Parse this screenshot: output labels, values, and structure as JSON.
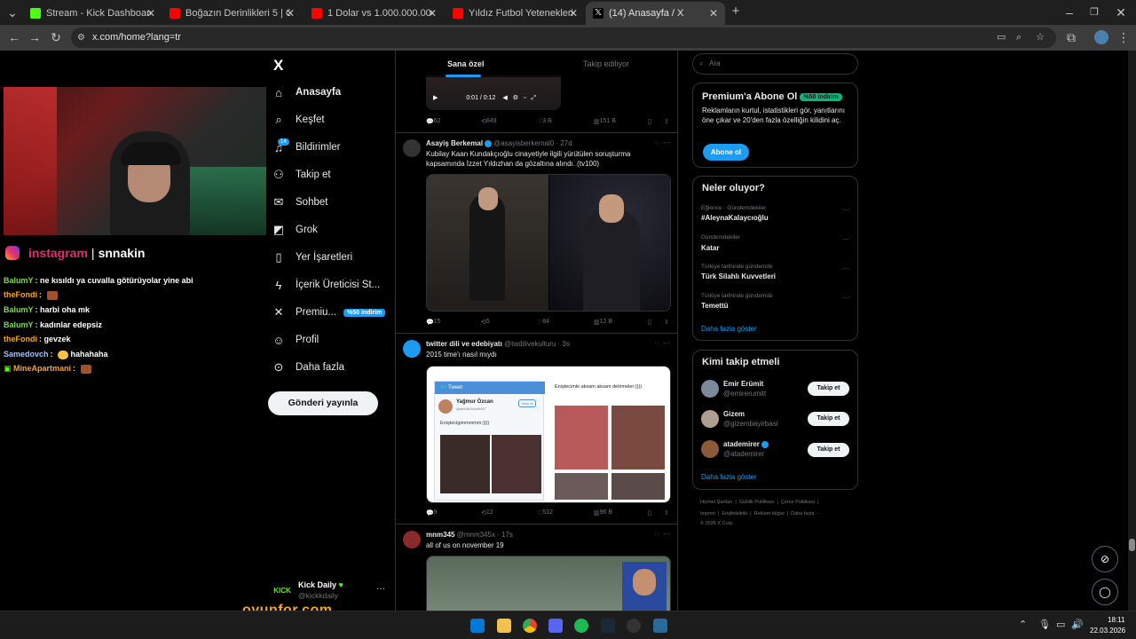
{
  "browser": {
    "tabs": [
      {
        "title": "Stream - Kick Dashboard",
        "color": "#53fc18"
      },
      {
        "title": "Boğazın Derinlikleri 5 | Ortaköy",
        "color": "#ff0000"
      },
      {
        "title": "1 Dolar vs 1.000.000.000 Dolar",
        "color": "#ff0000"
      },
      {
        "title": "Yıldız Futbol Yeteneklerimi Puan",
        "color": "#ff0000"
      },
      {
        "title": "(14) Anasayfa / X",
        "color": "#ffffff"
      }
    ],
    "url": "x.com/home?lang=tr"
  },
  "stream": {
    "instagram_label": "instagram",
    "instagram_sep": "|",
    "instagram_user": "snnakin",
    "chat": [
      {
        "user": "BalumY",
        "color": "#7ed957",
        "msg": "ne kısıldı ya cuvalla götürüyolar yine abi"
      },
      {
        "user": "theFondi",
        "color": "#f5a623",
        "msg": ""
      },
      {
        "user": "BalumY",
        "color": "#7ed957",
        "msg": "harbi oha mk"
      },
      {
        "user": "BalumY",
        "color": "#7ed957",
        "msg": "kadınlar edepsiz"
      },
      {
        "user": "theFondi",
        "color": "#f5a623",
        "msg": "gevzek"
      },
      {
        "user": "Samedovch",
        "color": "#a0c4ff",
        "msg": "hahahaha"
      },
      {
        "user": "MineApartmani",
        "color": "#f5a623",
        "msg": ""
      }
    ],
    "watermark": "oyunfor.com"
  },
  "nav": {
    "logo": "X",
    "items": [
      {
        "label": "Anasayfa",
        "icon": "home-icon"
      },
      {
        "label": "Keşfet",
        "icon": "search-icon"
      },
      {
        "label": "Bildirimler",
        "icon": "bell-icon"
      },
      {
        "label": "Takip et",
        "icon": "person-plus-icon"
      },
      {
        "label": "Sohbet",
        "icon": "mail-icon"
      },
      {
        "label": "Grok",
        "icon": "grok-icon"
      },
      {
        "label": "Yer İşaretleri",
        "icon": "bookmark-icon"
      },
      {
        "label": "İçerik Üreticisi St...",
        "icon": "lightning-icon"
      },
      {
        "label": "Premiu...",
        "icon": "x-icon"
      },
      {
        "label": "Profil",
        "icon": "person-icon"
      },
      {
        "label": "Daha fazla",
        "icon": "more-icon"
      }
    ],
    "premium_badge": "%50 indirim",
    "notif_count": "14",
    "post_button": "Gönderi yayınla",
    "account": {
      "avatar_text": "KICK",
      "name": "Kick Daily",
      "handle": "@kickkdaily"
    }
  },
  "timeline": {
    "tabs": [
      "Sana özel",
      "Takip ediliyor"
    ],
    "video_time": "0:01 / 0:12",
    "tweet0_actions": [
      "62",
      "849",
      "3 B",
      "151 B"
    ],
    "tweets": [
      {
        "name": "Asayiş Berkemal",
        "handle": "@asayisberkemal0 · 27d",
        "text": "Kubilay Kaan Kundakçıoğlu cinayetiyle ilgili yürütülen soruşturma kapsamında İzzet Yıldızhan da gözaltına alındı. (tv100)",
        "actions": [
          "15",
          "5",
          "84",
          "12 B"
        ]
      },
      {
        "name": "twitter dili ve edebiyatı",
        "handle": "@twdilivekulturu · 3s",
        "text": "2015 time'ı nasıl mıydı",
        "actions": [
          "9",
          "12",
          "532",
          "96 B"
        ],
        "media_tweet": "Tweet",
        "media_user": "Yağmur Özcan",
        "media_user_handle": "@afz0812s4d9447",
        "media_text1": "Eniştecigimmmmm:))))",
        "media_text2": "Eniştecimle aksam aksam delirmeler:))))",
        "media_follow": "Takip et"
      },
      {
        "name": "mnm345",
        "handle": "@mnm345x · 17s",
        "text": "all of us on november 19"
      }
    ]
  },
  "sidebar": {
    "search_placeholder": "Ara",
    "premium": {
      "title": "Premium'a Abone Ol",
      "badge": "%50 indirim",
      "text": "Reklamların kurtul, istatistikleri gör, yanıtlarını öne çıkar ve 20'den fazla özelliğin kilidini aç.",
      "button": "Abone ol"
    },
    "trends": {
      "title": "Neler oluyor?",
      "items": [
        {
          "category": "Eğlence · Gündemdekiler",
          "name": "#AleynaKalaycıoğlu"
        },
        {
          "category": "Gündemdekiler",
          "name": "Katar"
        },
        {
          "category": "Türkiye tarihinde gündemde",
          "name": "Türk Silahlı Kuvvetleri"
        },
        {
          "category": "Türkiye tarihinde gündemde",
          "name": "Temettü"
        }
      ],
      "show_more": "Daha fazla göster"
    },
    "who_to_follow": {
      "title": "Kimi takip etmeli",
      "items": [
        {
          "name": "Emir Erümit",
          "handle": "@emirerumitt",
          "color": "#7a8a9a"
        },
        {
          "name": "Gizem",
          "handle": "@gizembayirbasi",
          "color": "#b0a090"
        },
        {
          "name": "atademirer",
          "handle": "@atademirer",
          "color": "#8a5a3a"
        }
      ],
      "follow_label": "Takip et",
      "show_more": "Daha fazla göster"
    },
    "footer": {
      "row1": [
        "Hizmet Şartları",
        "Gizlilik Politikası",
        "Çerez Politikası"
      ],
      "row2": [
        "Imprint",
        "Erişilebilirlik",
        "Reklam bilgisi",
        "Daha fazla ···"
      ],
      "copyright": "© 2026 X Corp."
    }
  },
  "taskbar": {
    "time": "18:11",
    "date": "22.03.2026"
  }
}
